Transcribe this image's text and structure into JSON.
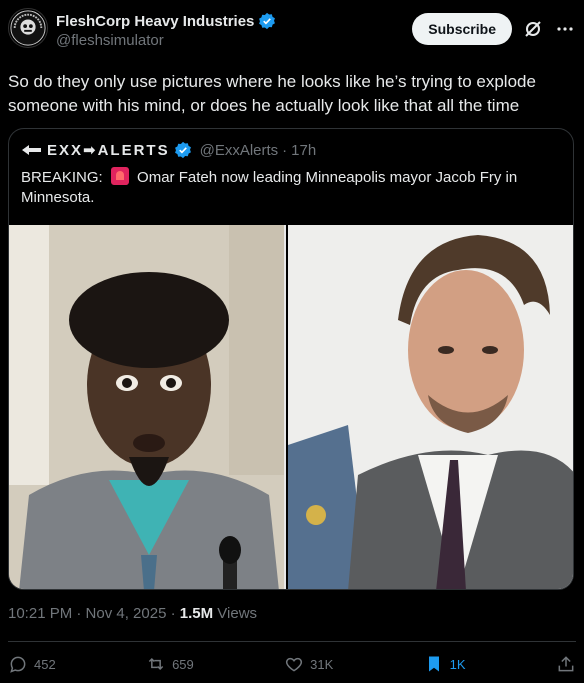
{
  "author": {
    "name": "FleshCorp Heavy Industries",
    "handle": "@fleshsimulator",
    "avatar_text": "FLESH SIMULATOR"
  },
  "header": {
    "subscribe_label": "Subscribe"
  },
  "tweet": {
    "text": "So do they only use pictures where he looks like he’s trying to explode someone with his mind, or does he actually look like that all the time",
    "time": "10:21 PM · Nov 4, 2025 · ",
    "views_count": "1.5M",
    "views_label": " Views"
  },
  "quote": {
    "logo_text": "EXX➡ALERTS",
    "handle": "@ExxAlerts",
    "age": "17h",
    "text_prefix": "BREAKING:",
    "text_body": "Omar Fateh now leading Minneapolis mayor Jacob Fry in Minnesota.",
    "images": [
      "left-portrait",
      "right-portrait"
    ]
  },
  "actions": {
    "replies": "452",
    "reposts": "659",
    "likes": "31K",
    "bookmarks": "1K"
  },
  "colors": {
    "accent": "#1d9bf0",
    "verified": "#1d9bf0",
    "bg": "#000000",
    "muted": "#71767b"
  }
}
